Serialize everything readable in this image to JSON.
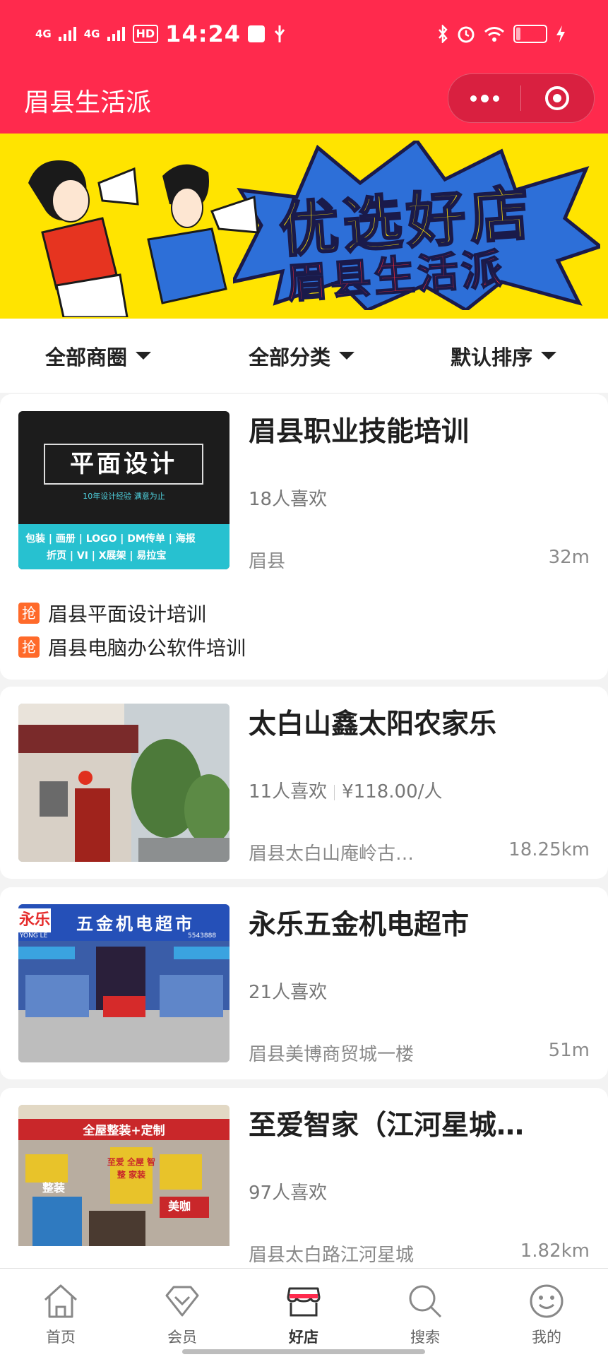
{
  "status_bar": {
    "signal1": "4G",
    "signal2": "4G",
    "hd": "HD",
    "time": "14:24",
    "battery": "14",
    "battery_level": 0.14
  },
  "header": {
    "title": "眉县生活派"
  },
  "banner": {
    "headline": "优选好店",
    "subline": "眉县生活派"
  },
  "filters": [
    {
      "label": "全部商圈"
    },
    {
      "label": "全部分类"
    },
    {
      "label": "默认排序"
    }
  ],
  "stores": [
    {
      "name": "眉县职业技能培训",
      "likes": "18人喜欢",
      "price": "",
      "address": "眉县",
      "distance": "32m",
      "thumb": {
        "title": "平面设计",
        "sub": "10年设计经验  满意为止",
        "tags1": "包装 | 画册 | LOGO | DM传单 | 海报",
        "tags2": "折页 |  VI  | X展架 | 易拉宝"
      },
      "promos": [
        {
          "badge": "抢",
          "text": "眉县平面设计培训"
        },
        {
          "badge": "抢",
          "text": "眉县电脑办公软件培训"
        }
      ]
    },
    {
      "name": "太白山鑫太阳农家乐",
      "likes": "11人喜欢",
      "price": "¥118.00/人",
      "address": "眉县太白山庵岭古…",
      "distance": "18.25km"
    },
    {
      "name": "永乐五金机电超市",
      "likes": "21人喜欢",
      "price": "",
      "address": "眉县美博商贸城一楼",
      "distance": "51m",
      "thumb": {
        "sign_brand": "永乐",
        "sign_text": "五金机电超市",
        "sign_sub": "YONG LE",
        "sign_phone": "5543888"
      }
    },
    {
      "name": "至爱智家（江河星城…",
      "likes": "97人喜欢",
      "price": "",
      "address": "眉县太白路江河星城",
      "distance": "1.82km",
      "thumb": {
        "sign_top": "全屋整装+定制",
        "sign_mid": "至爱 全屋 智整 家装",
        "sign_left": "整装",
        "sign_right": "美咖"
      }
    }
  ],
  "tabbar": [
    {
      "label": "首页",
      "icon": "home-icon"
    },
    {
      "label": "会员",
      "icon": "diamond-icon"
    },
    {
      "label": "好店",
      "icon": "store-icon",
      "active": true
    },
    {
      "label": "搜索",
      "icon": "search-icon"
    },
    {
      "label": "我的",
      "icon": "smiley-icon"
    }
  ],
  "colors": {
    "brand": "#ff2a4d",
    "banner_bg": "#ffe400",
    "promo_badge": "#ff6a2a"
  }
}
